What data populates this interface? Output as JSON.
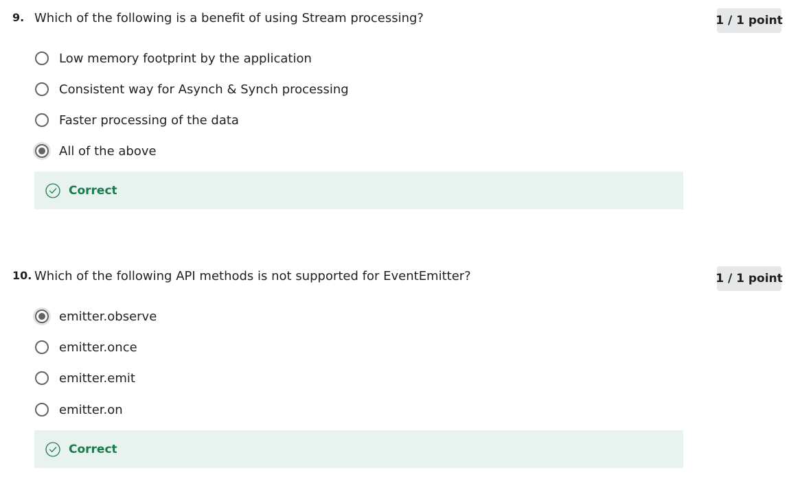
{
  "questions": [
    {
      "number": "9.",
      "text": "Which of the following is a benefit of using Stream processing?",
      "points": "1 / 1 point",
      "options": [
        {
          "label": "Low memory footprint by the application",
          "selected": false
        },
        {
          "label": "Consistent way for Asynch & Synch processing",
          "selected": false
        },
        {
          "label": "Faster processing of the data",
          "selected": false
        },
        {
          "label": "All of the above",
          "selected": true
        }
      ],
      "feedback": "Correct"
    },
    {
      "number": "10.",
      "text": "Which of the following API methods is not supported for EventEmitter?",
      "points": "1 / 1 point",
      "options": [
        {
          "label": "emitter.observe",
          "selected": true
        },
        {
          "label": "emitter.once",
          "selected": false
        },
        {
          "label": "emitter.emit",
          "selected": false
        },
        {
          "label": "emitter.on",
          "selected": false
        }
      ],
      "feedback": "Correct"
    }
  ],
  "colors": {
    "feedback_bg": "#e8f2ee",
    "feedback_text": "#1a7a4c",
    "badge_bg": "#e5e7e8",
    "radio_border": "#636363"
  },
  "icons": {
    "feedback": "check-circle-icon"
  }
}
